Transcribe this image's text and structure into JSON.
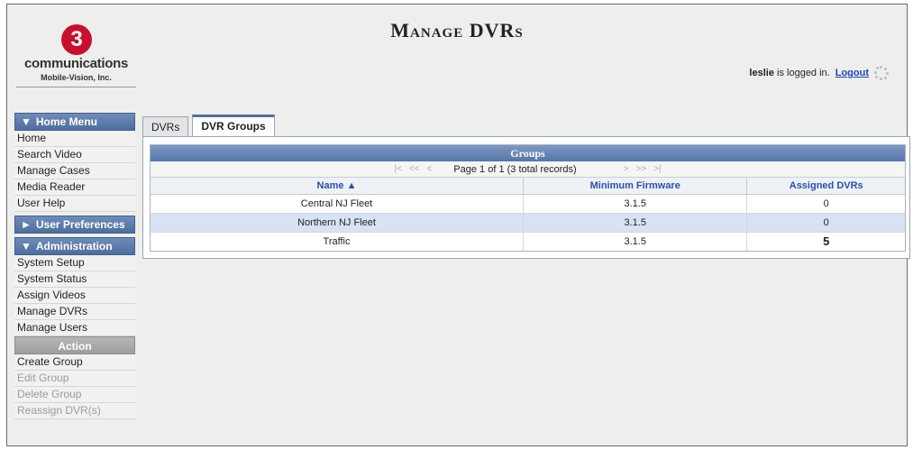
{
  "logo": {
    "mark": "3",
    "wordmark": "communications",
    "subtitle": "Mobile-Vision, Inc."
  },
  "page_title": "Manage DVRs",
  "login": {
    "user": "leslie",
    "status_text": "is logged in.",
    "logout_label": "Logout"
  },
  "sidebar": {
    "home_menu": {
      "header": "Home Menu",
      "items": [
        "Home",
        "Search Video",
        "Manage Cases",
        "Media Reader",
        "User Help"
      ]
    },
    "user_preferences": {
      "header": "User Preferences"
    },
    "administration": {
      "header": "Administration",
      "items": [
        "System Setup",
        "System Status",
        "Assign Videos",
        "Manage DVRs",
        "Manage Users"
      ]
    },
    "action": {
      "header": "Action",
      "items": [
        {
          "label": "Create Group",
          "enabled": true
        },
        {
          "label": "Edit Group",
          "enabled": false
        },
        {
          "label": "Delete Group",
          "enabled": false
        },
        {
          "label": "Reassign DVR(s)",
          "enabled": false
        }
      ]
    }
  },
  "tabs": [
    {
      "label": "DVRs",
      "active": false
    },
    {
      "label": "DVR Groups",
      "active": true
    }
  ],
  "table": {
    "title": "Groups",
    "pager": {
      "info": "Page 1 of 1 (3 total records)"
    },
    "columns": [
      "Name ▲",
      "Minimum Firmware",
      "Assigned DVRs"
    ],
    "rows": [
      {
        "name": "Central NJ Fleet",
        "firmware": "3.1.5",
        "assigned": "0"
      },
      {
        "name": "Northern NJ Fleet",
        "firmware": "3.1.5",
        "assigned": "0"
      },
      {
        "name": "Traffic",
        "firmware": "3.1.5",
        "assigned": "5"
      }
    ]
  },
  "colors": {
    "header_blue": "#5676a8",
    "link_blue": "#2a4fb0",
    "brand_red": "#c8102e",
    "row_highlight": "#d9e2f3"
  }
}
